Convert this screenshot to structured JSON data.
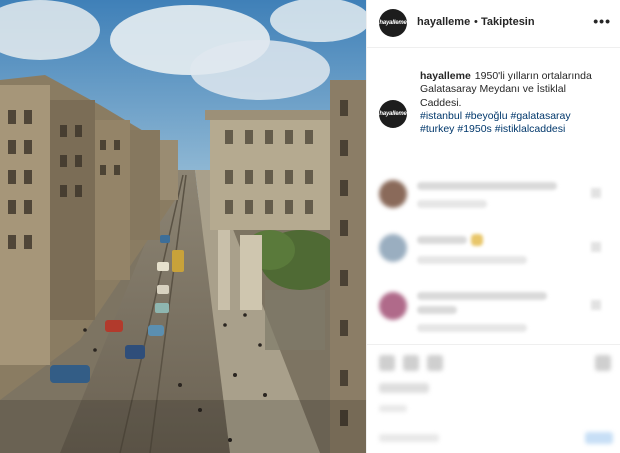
{
  "post": {
    "author": "hayalleme",
    "separator": "•",
    "follow_status": "Takiptesin",
    "more_icon": "more-options-icon",
    "avatar_logo": "hayalleme"
  },
  "caption": {
    "author": "hayalleme",
    "text": "1950'li yılların ortalarında Galatasaray Meydanı ve İstiklal Caddesi.",
    "hashtags": [
      "#istanbul",
      "#beyoğlu",
      "#galatasaray",
      "#turkey",
      "#1950s",
      "#istiklalcaddesi"
    ]
  },
  "comments_blurred": 3,
  "colors": {
    "tag": "#00376b",
    "text": "#262626",
    "border": "#efefef"
  }
}
